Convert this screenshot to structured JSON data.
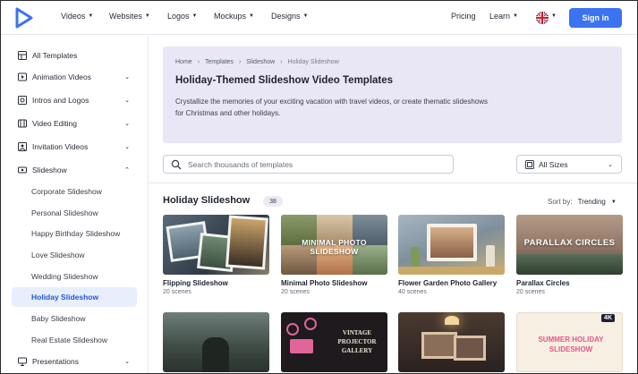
{
  "nav": {
    "items": [
      {
        "label": "Videos"
      },
      {
        "label": "Websites"
      },
      {
        "label": "Logos"
      },
      {
        "label": "Mockups"
      },
      {
        "label": "Designs"
      }
    ],
    "pricing": "Pricing",
    "learn": "Learn",
    "sign_in": "Sign in",
    "flag_icon": "uk-flag-icon",
    "accent": "#3b73f0"
  },
  "sidebar": {
    "items": [
      {
        "label": "All Templates",
        "icon": "templates-grid-icon"
      },
      {
        "label": "Animation Videos",
        "icon": "play-icon"
      },
      {
        "label": "Intros and Logos",
        "icon": "logo-icon"
      },
      {
        "label": "Video Editing",
        "icon": "editing-icon"
      },
      {
        "label": "Invitation Videos",
        "icon": "invitation-icon"
      },
      {
        "label": "Slideshow",
        "icon": "slideshow-icon"
      },
      {
        "label": "Presentations",
        "icon": "presentation-icon"
      }
    ],
    "slideshow_subitems": [
      {
        "label": "Corporate Slideshow"
      },
      {
        "label": "Personal Slideshow"
      },
      {
        "label": "Happy Birthday Slideshow"
      },
      {
        "label": "Love Slideshow"
      },
      {
        "label": "Wedding Slideshow"
      },
      {
        "label": "Holiday Slideshow"
      },
      {
        "label": "Baby Slideshow"
      },
      {
        "label": "Real Estate Slideshow"
      }
    ],
    "active_label": "Holiday Slideshow"
  },
  "hero": {
    "breadcrumbs": [
      "Home",
      "Templates",
      "Slideshow",
      "Holiday Slideshow"
    ],
    "title": "Holiday-Themed Slideshow Video Templates",
    "description": "Crystallize the memories of your exciting vacation with travel videos, or create thematic slideshows for Christmas and other holidays."
  },
  "search": {
    "placeholder": "Search thousands of templates",
    "sizes_label": "All Sizes"
  },
  "section": {
    "title": "Holiday Slideshow",
    "count": "38",
    "sort_label": "Sort by:",
    "sort_value": "Trending"
  },
  "cards": [
    {
      "title": "Flipping Slideshow",
      "scenes": "20 scenes",
      "overlay": ""
    },
    {
      "title": "Minimal Photo Slideshow",
      "scenes": "20 scenes",
      "overlay": "MINIMAL PHOTO SLIDESHOW"
    },
    {
      "title": "Flower Garden Photo Gallery",
      "scenes": "40 scenes",
      "overlay": ""
    },
    {
      "title": "Parallax Circles",
      "scenes": "20 scenes",
      "overlay": "PARALLAX CIRCLES"
    }
  ],
  "cards_row2": [
    {
      "overlay": ""
    },
    {
      "overlay": "VINTAGE PROJECTOR GALLERY"
    },
    {
      "overlay": ""
    },
    {
      "overlay": "SUMMER HOLIDAY SLIDESHOW",
      "badge": "4K"
    }
  ]
}
